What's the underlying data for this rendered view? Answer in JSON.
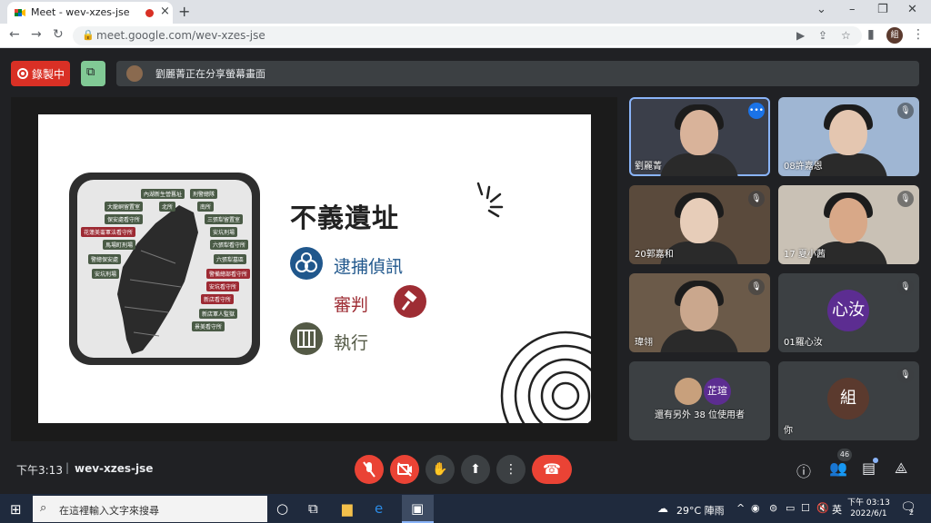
{
  "browser": {
    "tab_title": "Meet - wev-xzes-jse",
    "url": "meet.google.com/wev-xzes-jse",
    "profile_initial": "組"
  },
  "meet_top": {
    "recording_label": "錄製中",
    "presenting_banner": "劉麗菁正在分享螢幕畫面"
  },
  "slide": {
    "title": "不義遺址",
    "steps": [
      "逮捕偵訊",
      "審判",
      "執行"
    ],
    "map_tags": [
      {
        "text": "內湖新生營舊址",
        "kind": "g"
      },
      {
        "text": "刑警總隊",
        "kind": "g"
      },
      {
        "text": "大龍峒留置室",
        "kind": "g"
      },
      {
        "text": "北所",
        "kind": "g"
      },
      {
        "text": "南所",
        "kind": "g"
      },
      {
        "text": "保安處看守所",
        "kind": "g"
      },
      {
        "text": "三張犁留置室",
        "kind": "g"
      },
      {
        "text": "花蓮美崙軍法看守所",
        "kind": "r"
      },
      {
        "text": "安坑刑場",
        "kind": "g"
      },
      {
        "text": "馬場町刑場",
        "kind": "g"
      },
      {
        "text": "六張犁看守所",
        "kind": "g"
      },
      {
        "text": "警總保安處",
        "kind": "g"
      },
      {
        "text": "六張犁墓區",
        "kind": "g"
      },
      {
        "text": "安坑刑場",
        "kind": "g"
      },
      {
        "text": "警備總部看守所",
        "kind": "r"
      },
      {
        "text": "安坑看守所",
        "kind": "r"
      },
      {
        "text": "新店看守所",
        "kind": "r"
      },
      {
        "text": "新店軍人監獄",
        "kind": "g"
      },
      {
        "text": "景美看守所",
        "kind": "g"
      }
    ]
  },
  "participants": [
    {
      "name": "劉麗菁",
      "kind": "video",
      "bg": "#3b3f4a",
      "face": "#d9b39a",
      "active": true
    },
    {
      "name": "08許嘉恩",
      "kind": "video",
      "bg": "#9fb6d3",
      "face": "#e4c6b0",
      "active": false
    },
    {
      "name": "20郭嘉和",
      "kind": "video",
      "bg": "#5a4a3c",
      "face": "#e7cdb9",
      "active": false
    },
    {
      "name": "17 夏小茜",
      "kind": "video",
      "bg": "#c9c1b5",
      "face": "#d8a888",
      "active": false
    },
    {
      "name": "瑋翎",
      "kind": "video",
      "bg": "#6b5a49",
      "face": "#caa78d",
      "active": false
    },
    {
      "name": "01羅心汝",
      "kind": "avatar",
      "avatar_text": "心汝",
      "avatar_color": "#5c2d91"
    },
    {
      "name": "還有另外 38 位使用者",
      "kind": "group",
      "avatar_text": "芷瑄",
      "avatar_color": "#5c2d91"
    },
    {
      "name": "你",
      "kind": "avatar",
      "avatar_text": "組",
      "avatar_color": "#5b3a2e"
    }
  ],
  "bottom": {
    "time": "下午3:13",
    "separator": "|",
    "meeting_code": "wev-xzes-jse",
    "participant_count": "46"
  },
  "taskbar": {
    "search_placeholder": "在這裡輸入文字來搜尋",
    "weather": "29°C  陣雨",
    "ime": "英",
    "clock_time": "下午 03:13",
    "clock_date": "2022/6/1",
    "notif_count": "2"
  }
}
